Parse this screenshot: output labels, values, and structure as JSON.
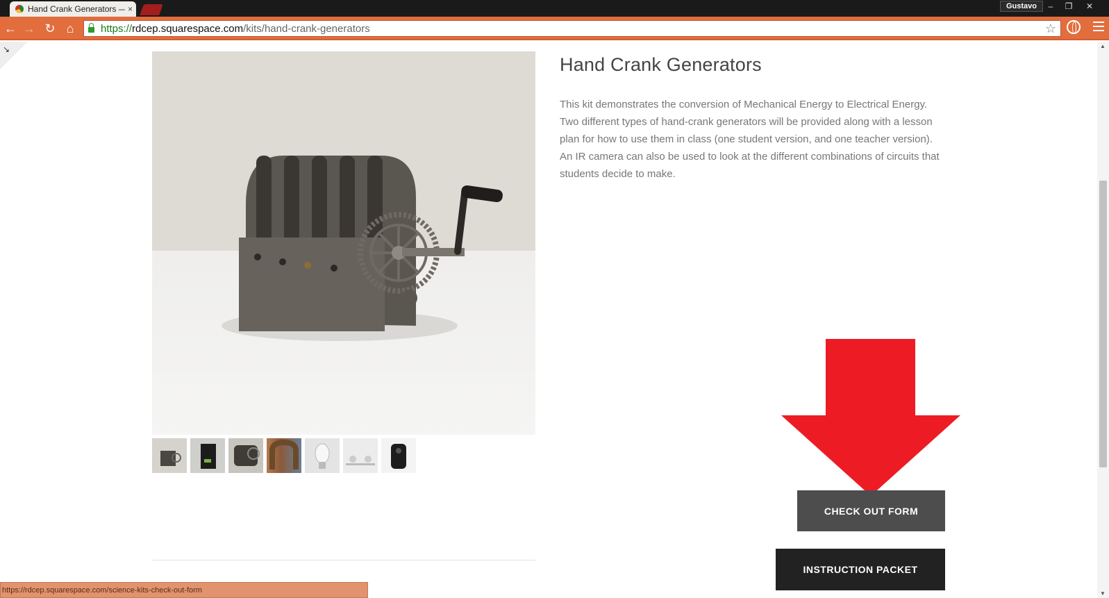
{
  "browser": {
    "tab_title": "Hand Crank Generators —",
    "tab_close": "×",
    "profile_name": "Gustavo",
    "window_controls": {
      "minimize": "–",
      "restore": "❐",
      "close": "✕"
    },
    "nav": {
      "back": "←",
      "forward": "→",
      "reload": "↻",
      "home": "⌂"
    },
    "url_scheme": "https://",
    "url_host": "rdcep.squarespace.com",
    "url_path": "/kits/hand-crank-generators",
    "star": "☆",
    "status_url": "https://rdcep.squarespace.com/science-kits-check-out-form"
  },
  "product": {
    "title": "Hand Crank Generators",
    "description": "This kit demonstrates the conversion of Mechanical Energy to Electrical Energy. Two different types of hand-crank generators will be provided along with a lesson plan for how to use them in class (one student version, and one teacher version). An IR camera can also be used to look at the different combinations of circuits that students decide to make.",
    "thumbnail_count": 7
  },
  "buttons": {
    "checkout": "CHECK OUT FORM",
    "instruction": "INSTRUCTION PACKET"
  },
  "colors": {
    "toolbar": "#e26d3d",
    "arrow": "#ed1c24",
    "checkout_button": "#4d4d4d",
    "instruction_button": "#222222"
  },
  "icons": {
    "corner": "↘",
    "scroll_up": "▲",
    "scroll_down": "▼"
  }
}
